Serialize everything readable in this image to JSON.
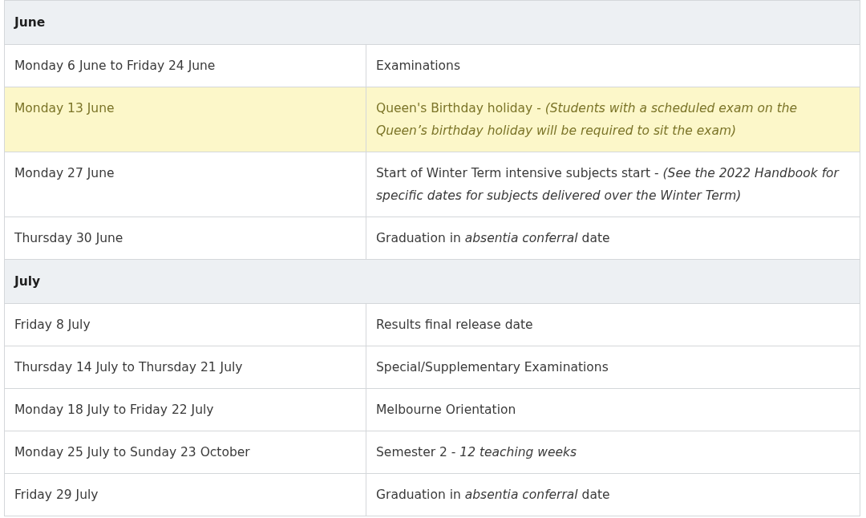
{
  "sections": [
    {
      "month": "June",
      "rows": [
        {
          "date": "Monday 6 June to Friday 24 June",
          "event": "Examinations",
          "highlighted": false
        },
        {
          "date": "Monday 13 June",
          "event": "Queen's Birthday holiday - *(Students with a scheduled exam on the Queen’s birthday holiday will be required to sit the exam)*",
          "highlighted": true
        },
        {
          "date": "Monday 27 June",
          "event": "Start of Winter Term intensive subjects start - *(See the 2022 Handbook for specific dates for subjects delivered over the Winter Term)*",
          "highlighted": false
        },
        {
          "date": "Thursday 30 June",
          "event": "Graduation in *absentia conferral* date",
          "highlighted": false
        }
      ]
    },
    {
      "month": "July",
      "rows": [
        {
          "date": "Friday 8 July",
          "event": "Results final release date",
          "highlighted": false
        },
        {
          "date": "Thursday 14 July to Thursday 21 July",
          "event": "Special/Supplementary Examinations",
          "highlighted": false
        },
        {
          "date": "Monday 18 July to Friday 22 July",
          "event": "Melbourne Orientation",
          "highlighted": false
        },
        {
          "date": "Monday 25 July to Sunday 23 October",
          "event": "Semester 2 - *12 teaching weeks*",
          "highlighted": false
        },
        {
          "date": "Friday 29 July",
          "event": "Graduation in *absentia conferral* date",
          "highlighted": false
        }
      ]
    }
  ]
}
